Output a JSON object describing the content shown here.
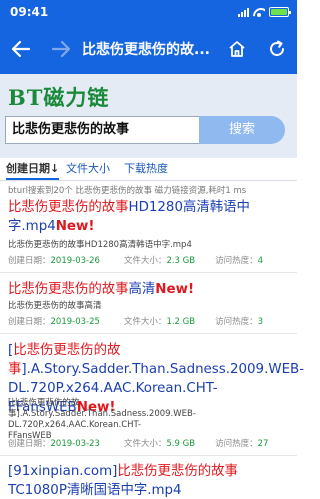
{
  "status_bar": {
    "time": "09:41"
  },
  "nav": {
    "title": "比悲伤更悲伤的故..."
  },
  "header": {
    "logo": "BT磁力链",
    "search_value": "比悲伤更悲伤的故事",
    "search_button": "搜索"
  },
  "sort_tabs": [
    {
      "label": "创建日期",
      "arrow": "↓"
    },
    {
      "label": "文件大小"
    },
    {
      "label": "下载热度"
    }
  ],
  "search_info": "bturl搜索到20个 比悲伤更悲伤的故事 磁力链接资源,耗时1 ms",
  "meta_labels": {
    "created": "创建日期：",
    "size": "文件大小：",
    "heat": "访问热度："
  },
  "results": [
    {
      "title_pre": "",
      "keyword": "比悲伤更悲伤的故事",
      "title_post": "HD1280高清韩语中字.mp4",
      "new": "New!",
      "desc": "比悲伤更悲伤的故事HD1280高清韩语中字.mp4",
      "created": "2019-03-26",
      "size": "2.3 GB",
      "heat": "4"
    },
    {
      "title_pre": "",
      "keyword": "比悲伤更悲伤的故事",
      "title_post": "高清",
      "new": "New!",
      "desc": "比悲伤更悲伤的故事高清",
      "created": "2019-03-25",
      "size": "1.2 GB",
      "heat": "3"
    },
    {
      "title_pre": "[",
      "keyword": "比悲伤更悲伤的故事",
      "title_post": "].A.Story.Sadder.Than.Sadness.2009.WEB-DL.720P.x264.AAC.Korean.CHT-FFansWEB",
      "new": "New!",
      "desc": "[比悲伤更悲伤的故事].A.Story.Sadder.Than.Sadness.2009.WEB-DL.720P.x264.AAC.Korean.CHT-FFansWEB",
      "created": "2019-03-23",
      "size": "5.9 GB",
      "heat": "27"
    },
    {
      "title_pre": "[91xinpian.com]",
      "keyword": "比悲伤更悲伤的故事",
      "title_post": "TC1080P清晰国语中字.mp4",
      "new": "",
      "desc": "",
      "created": "",
      "size": "",
      "heat": ""
    }
  ]
}
